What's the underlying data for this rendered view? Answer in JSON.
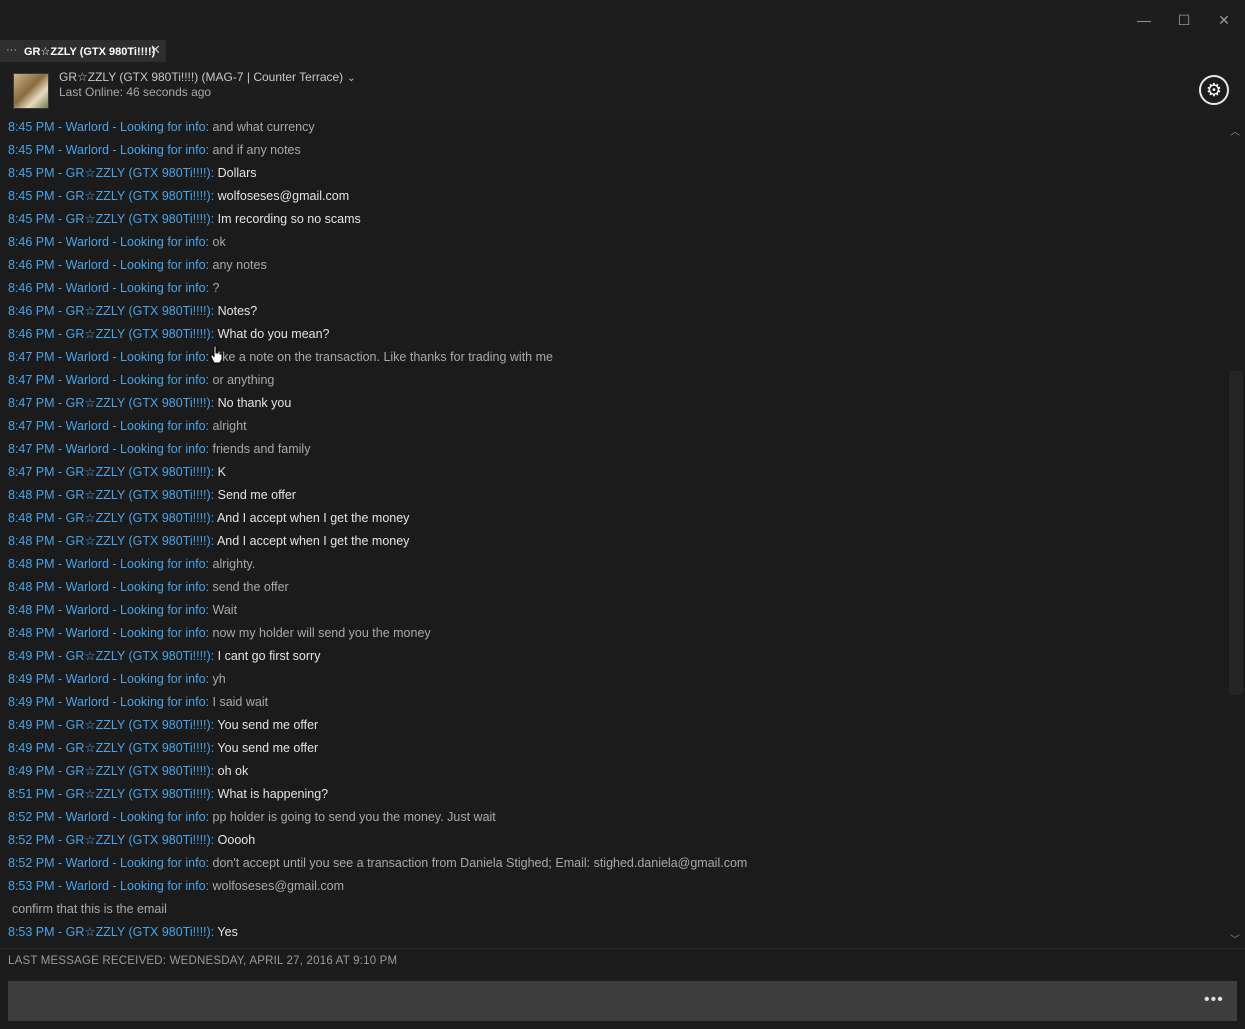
{
  "window": {
    "minimize_glyph": "—",
    "maximize_glyph": "☐",
    "close_glyph": "✕"
  },
  "tab": {
    "title": "GR☆ZZLY (GTX 980Ti!!!!)",
    "dots": "···",
    "close_glyph": "✕"
  },
  "header": {
    "friend_name": "GR☆ZZLY (GTX 980Ti!!!!) (MAG-7 | Counter Terrace)",
    "chevron": "⌄",
    "status": "Last Online: 46 seconds ago",
    "settings_glyph": "⚙"
  },
  "messages": [
    {
      "meta": "8:45 PM - Warlord - Looking for info",
      "text": "and what currency",
      "who": "other"
    },
    {
      "meta": "8:45 PM - Warlord - Looking for info",
      "text": "and if any notes",
      "who": "other"
    },
    {
      "meta": "8:45 PM - GR☆ZZLY (GTX 980Ti!!!!)",
      "text": "Dollars",
      "who": "self"
    },
    {
      "meta": "8:45 PM - GR☆ZZLY (GTX 980Ti!!!!)",
      "text": "wolfoseses@gmail.com",
      "who": "self"
    },
    {
      "meta": "8:45 PM - GR☆ZZLY (GTX 980Ti!!!!)",
      "text": "Im recording so no scams",
      "who": "self"
    },
    {
      "meta": "8:46 PM - Warlord - Looking for info",
      "text": "ok",
      "who": "other"
    },
    {
      "meta": "8:46 PM - Warlord - Looking for info",
      "text": "any notes",
      "who": "other"
    },
    {
      "meta": "8:46 PM - Warlord - Looking for info",
      "text": "?",
      "who": "other"
    },
    {
      "meta": "8:46 PM - GR☆ZZLY (GTX 980Ti!!!!)",
      "text": "Notes?",
      "who": "self"
    },
    {
      "meta": "8:46 PM - GR☆ZZLY (GTX 980Ti!!!!)",
      "text": "What do you mean?",
      "who": "self"
    },
    {
      "meta": "8:47 PM - Warlord - Looking for info",
      "text": "Like a note on the transaction. Like thanks for trading with me",
      "who": "other"
    },
    {
      "meta": "8:47 PM - Warlord - Looking for info",
      "text": "or anything",
      "who": "other"
    },
    {
      "meta": "8:47 PM - GR☆ZZLY (GTX 980Ti!!!!)",
      "text": "No thank you",
      "who": "self"
    },
    {
      "meta": "8:47 PM - Warlord - Looking for info",
      "text": "alright",
      "who": "other"
    },
    {
      "meta": "8:47 PM - Warlord - Looking for info",
      "text": "friends and family",
      "who": "other"
    },
    {
      "meta": "8:47 PM - GR☆ZZLY (GTX 980Ti!!!!)",
      "text": "K",
      "who": "self"
    },
    {
      "meta": "8:48 PM - GR☆ZZLY (GTX 980Ti!!!!)",
      "text": "Send me offer",
      "who": "self"
    },
    {
      "meta": "8:48 PM - GR☆ZZLY (GTX 980Ti!!!!)",
      "text": "And I accept when I get the money",
      "who": "self"
    },
    {
      "meta": "8:48 PM - GR☆ZZLY (GTX 980Ti!!!!)",
      "text": "And I accept when I get the money",
      "who": "self"
    },
    {
      "meta": "8:48 PM - Warlord - Looking for info",
      "text": "alrighty.",
      "who": "other"
    },
    {
      "meta": "8:48 PM - Warlord - Looking for info",
      "text": "send the offer",
      "who": "other"
    },
    {
      "meta": "8:48 PM - Warlord - Looking for info",
      "text": "Wait",
      "who": "other"
    },
    {
      "meta": "8:48 PM - Warlord - Looking for info",
      "text": "now my holder will send you the money",
      "who": "other"
    },
    {
      "meta": "8:49 PM - GR☆ZZLY (GTX 980Ti!!!!)",
      "text": "I cant go first sorry",
      "who": "self"
    },
    {
      "meta": "8:49 PM - Warlord - Looking for info",
      "text": "yh",
      "who": "other"
    },
    {
      "meta": "8:49 PM - Warlord - Looking for info",
      "text": "I said wait",
      "who": "other"
    },
    {
      "meta": "8:49 PM - GR☆ZZLY (GTX 980Ti!!!!)",
      "text": "You send me offer",
      "who": "self"
    },
    {
      "meta": "8:49 PM - GR☆ZZLY (GTX 980Ti!!!!)",
      "text": "You send me offer",
      "who": "self"
    },
    {
      "meta": "8:49 PM - GR☆ZZLY (GTX 980Ti!!!!)",
      "text": "oh ok",
      "who": "self"
    },
    {
      "meta": "8:51 PM - GR☆ZZLY (GTX 980Ti!!!!)",
      "text": "What is happening?",
      "who": "self"
    },
    {
      "meta": "8:52 PM - Warlord - Looking for info",
      "text": "pp holder is going to send you the money. Just wait",
      "who": "other"
    },
    {
      "meta": "8:52 PM - GR☆ZZLY (GTX 980Ti!!!!)",
      "text": "Ooooh",
      "who": "self"
    },
    {
      "meta": "8:52 PM - Warlord - Looking for info",
      "text": "don't accept until you see a transaction from Daniela Stighed; Email: stighed.daniela@gmail.com",
      "who": "other"
    },
    {
      "meta": "8:53 PM - Warlord - Looking for info",
      "text": "wolfoseses@gmail.com",
      "who": "other"
    },
    {
      "meta": "",
      "text": "confirm that this is the email",
      "who": "cont"
    },
    {
      "meta": "8:53 PM - GR☆ZZLY (GTX 980Ti!!!!)",
      "text": "Yes",
      "who": "self"
    }
  ],
  "status_bar": {
    "text": "LAST MESSAGE RECEIVED: WEDNESDAY, APRIL 27, 2016 AT 9:10 PM"
  },
  "composer": {
    "placeholder": "",
    "more_glyph": "•••"
  },
  "scrollbar": {
    "up_glyph": "︿",
    "down_glyph": "﹀"
  }
}
